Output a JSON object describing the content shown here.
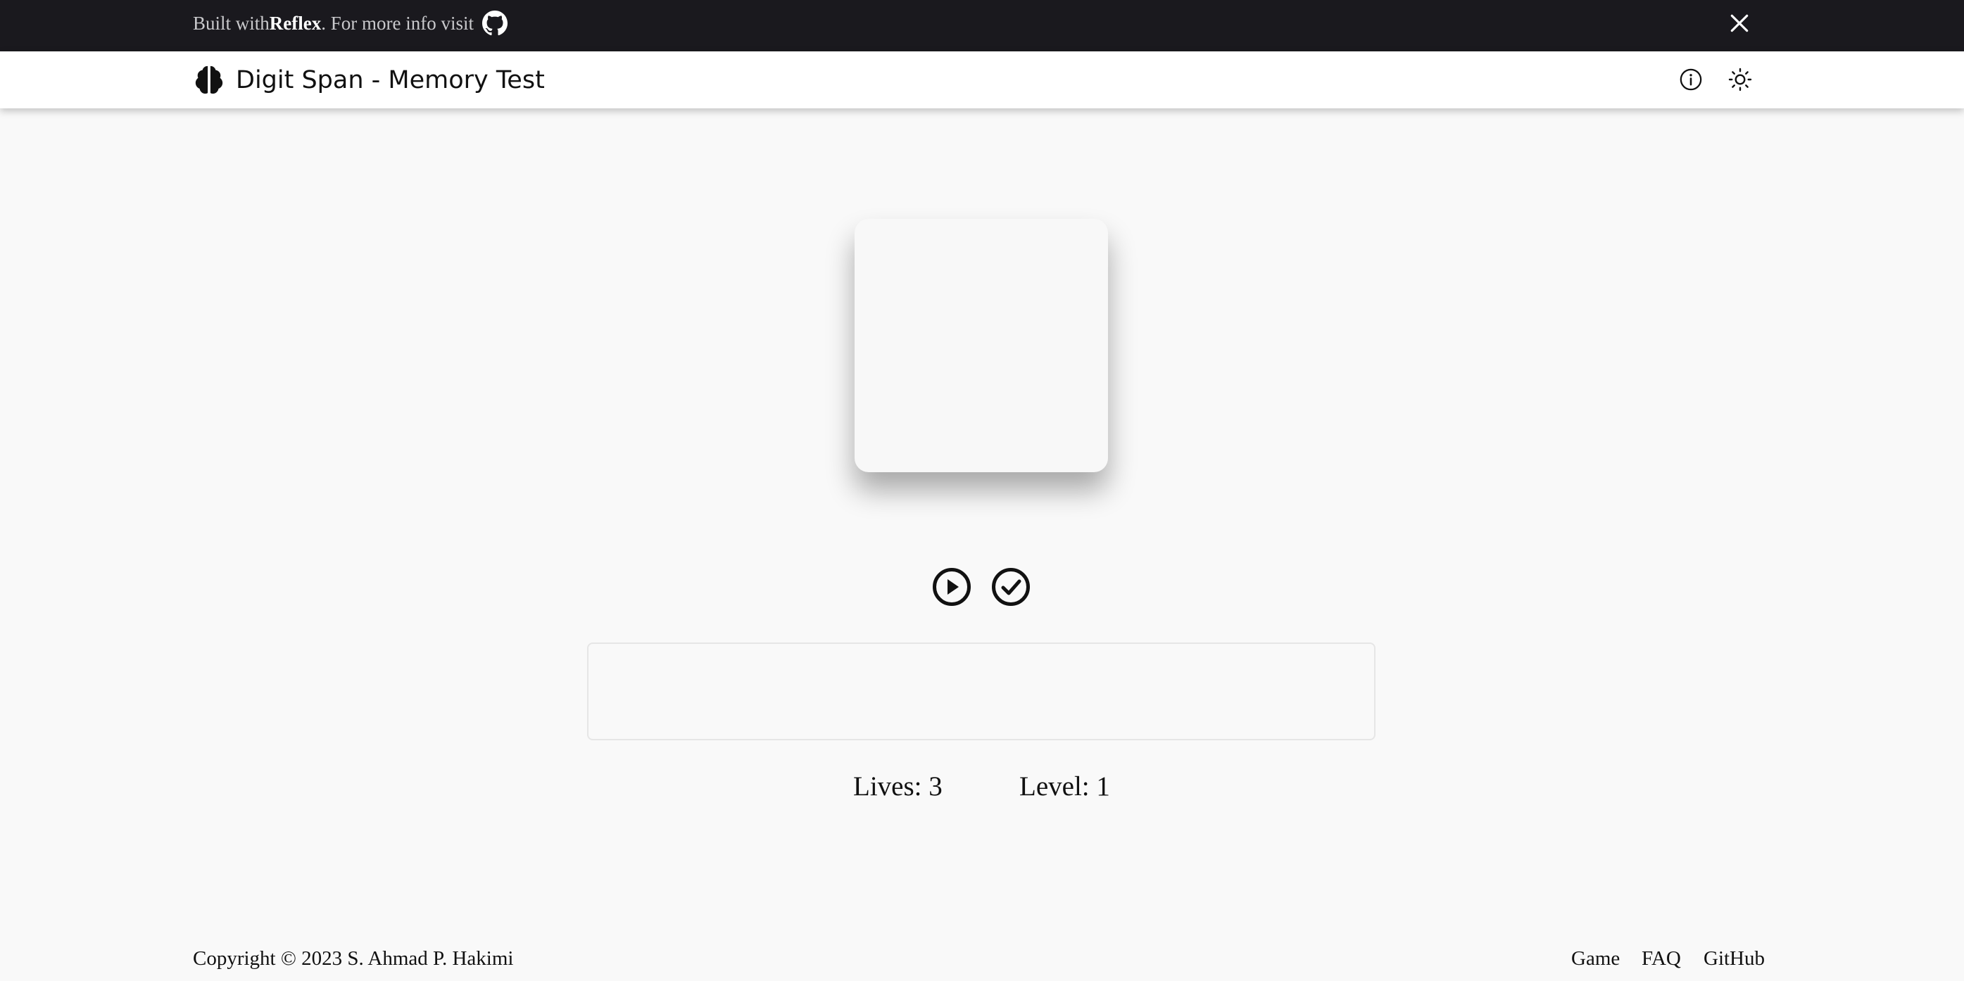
{
  "banner": {
    "prefix": "Built with ",
    "brand": "Reflex",
    "suffix": ". For more info visit",
    "github_icon": "github-icon",
    "close_icon": "close-icon"
  },
  "header": {
    "title": "Digit Span - Memory Test",
    "logo_icon": "brain-icon",
    "info_icon": "info-icon",
    "theme_icon": "sun-icon"
  },
  "game": {
    "current_digit": "",
    "answer_value": "",
    "play_icon": "play-circle-icon",
    "submit_icon": "check-circle-icon",
    "lives_label": "Lives: 3",
    "level_label": "Level: 1"
  },
  "footer": {
    "copyright": "Copyright © 2023 S. Ahmad P. Hakimi",
    "links": [
      {
        "label": "Game"
      },
      {
        "label": "FAQ"
      },
      {
        "label": "GitHub"
      }
    ]
  },
  "colors": {
    "banner_bg": "#1a191e",
    "header_bg": "#ffffff",
    "page_bg": "#f9f9f9",
    "text": "#111111"
  }
}
